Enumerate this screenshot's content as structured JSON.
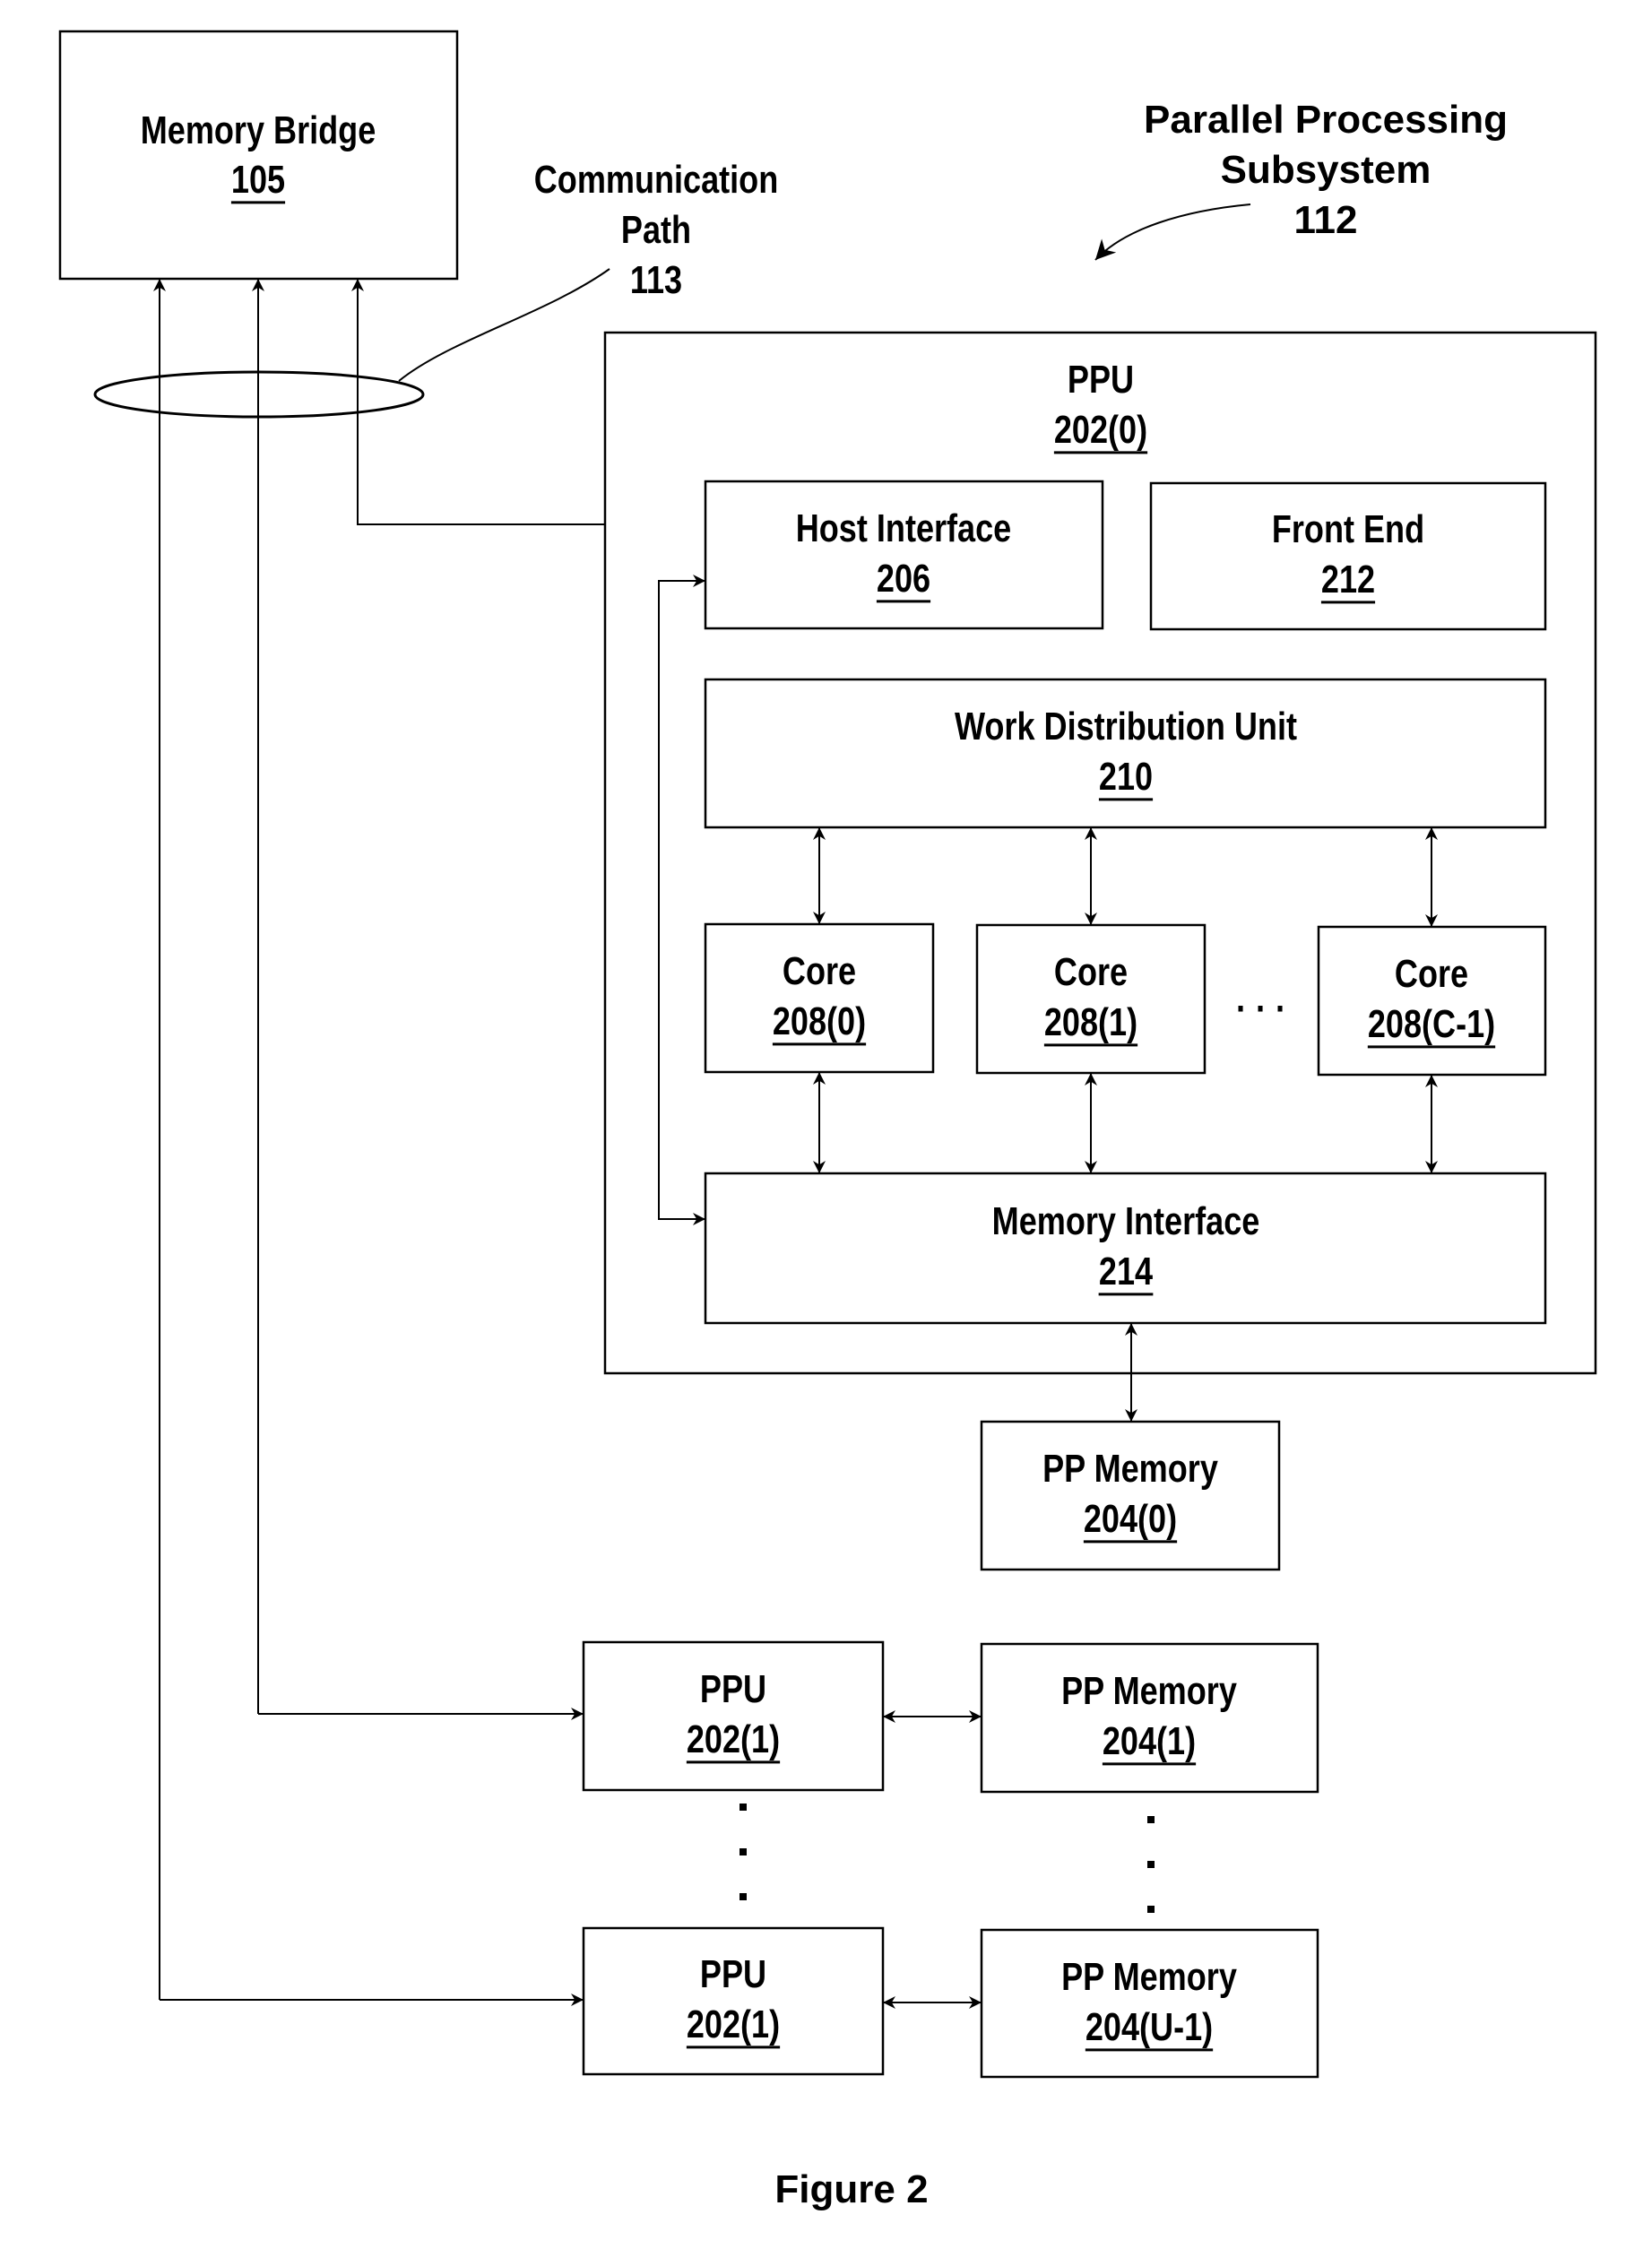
{
  "figure_caption": "Figure 2",
  "colors": {
    "line": "#000000",
    "background": "#ffffff"
  },
  "callouts": {
    "communication_path": {
      "lines": [
        "Communication",
        "Path",
        "113"
      ]
    },
    "parallel_processing_subsystem": {
      "lines": [
        "Parallel Processing",
        "Subsystem",
        "112"
      ]
    }
  },
  "blocks": {
    "memory_bridge": {
      "name": "Memory Bridge",
      "ref": "105"
    },
    "ppu0": {
      "name": "PPU",
      "ref": "202(0)"
    },
    "host_interface": {
      "name": "Host Interface",
      "ref": "206"
    },
    "front_end": {
      "name": "Front End",
      "ref": "212"
    },
    "work_distribution_unit": {
      "name": "Work Distribution Unit",
      "ref": "210"
    },
    "cores": [
      {
        "name": "Core",
        "ref": "208(0)"
      },
      {
        "name": "Core",
        "ref": "208(1)"
      },
      {
        "name": "Core",
        "ref": "208(C-1)"
      }
    ],
    "memory_interface": {
      "name": "Memory Interface",
      "ref": "214"
    },
    "pp_memory0": {
      "name": "PP Memory",
      "ref": "204(0)"
    },
    "ppu1": {
      "name": "PPU",
      "ref": "202(1)"
    },
    "pp_memory1": {
      "name": "PP Memory",
      "ref": "204(1)"
    },
    "ppu_last": {
      "name": "PPU",
      "ref": "202(1)"
    },
    "pp_memory_last": {
      "name": "PP Memory",
      "ref": "204(U-1)"
    }
  },
  "ellipsis": {
    "cores": "· · ·"
  }
}
